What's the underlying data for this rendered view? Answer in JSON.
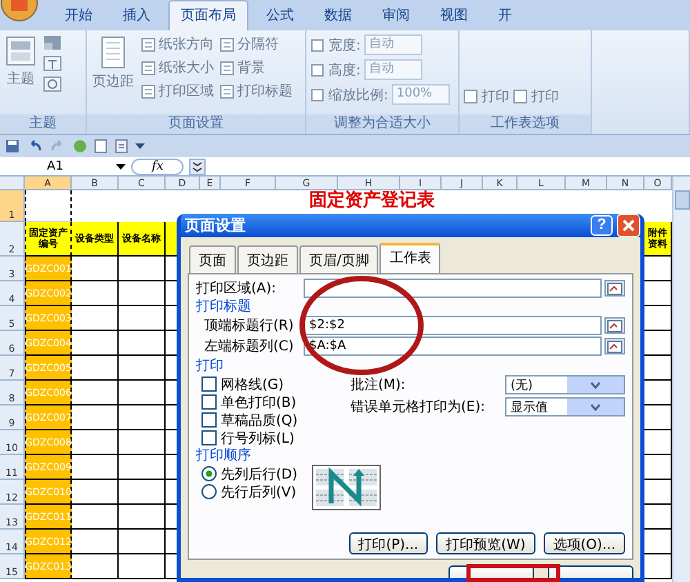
{
  "ribbon_tabs": [
    {
      "label": "开始",
      "selected": false
    },
    {
      "label": "插入",
      "selected": false
    },
    {
      "label": "页面布局",
      "selected": true
    },
    {
      "label": "公式",
      "selected": false
    },
    {
      "label": "数据",
      "selected": false
    },
    {
      "label": "审阅",
      "selected": false
    },
    {
      "label": "视图",
      "selected": false
    },
    {
      "label": "开",
      "selected": false
    }
  ],
  "theme_group": {
    "button": "主题",
    "label": "主题"
  },
  "page_setup_group": {
    "large_button": "页边距",
    "commands": [
      "纸张方向",
      "纸张大小",
      "打印区域",
      "分隔符",
      "背景",
      "打印标题"
    ],
    "label": "页面设置"
  },
  "scale_group": {
    "fields": [
      {
        "label": "宽度:",
        "value": "自动"
      },
      {
        "label": "高度:",
        "value": "自动"
      },
      {
        "label": "缩放比例:",
        "value": "100%"
      }
    ],
    "label": "调整为合适大小"
  },
  "sheet_options_group": {
    "checkboxes": [
      {
        "label": "打印",
        "checked": false
      },
      {
        "label": "打印",
        "checked": false
      }
    ],
    "label": "工作表选项"
  },
  "formula_bar": {
    "name_box": "A1",
    "function_icon": "fx"
  },
  "sheet": {
    "columns": [
      "A",
      "B",
      "C",
      "D",
      "E",
      "F",
      "G",
      "H",
      "I",
      "J",
      "K",
      "L",
      "M",
      "N",
      "O"
    ],
    "rows": [
      "1",
      "2",
      "3",
      "4",
      "5",
      "6",
      "7",
      "8",
      "9",
      "10",
      "11",
      "12",
      "13",
      "14",
      "15"
    ],
    "title": "固定资产登记表",
    "headers_left": [
      "固定资产编号",
      "设备类型",
      "设备名称"
    ],
    "header_right": "附件资料",
    "asset_ids": [
      "GDZC001",
      "GDZC002",
      "GDZC003",
      "GDZC004",
      "GDZC005",
      "GDZC006",
      "GDZC007",
      "GDZC008",
      "GDZC009",
      "GDZC010",
      "GDZC011",
      "GDZC012",
      "GDZC013"
    ]
  },
  "dialog": {
    "title": "页面设置",
    "help_button": "?",
    "tabs": [
      {
        "label": "页面",
        "selected": false
      },
      {
        "label": "页边距",
        "selected": false
      },
      {
        "label": "页眉/页脚",
        "selected": false
      },
      {
        "label": "工作表",
        "selected": true
      }
    ],
    "print_area": {
      "label": "打印区域(A):"
    },
    "print_titles": {
      "heading": "打印标题",
      "fields": [
        {
          "label": "顶端标题行(R)",
          "value": "$2:$2"
        },
        {
          "label": "左端标题列(C)",
          "value": "$A:$A"
        }
      ]
    },
    "print": {
      "heading": "打印",
      "checkboxes": [
        {
          "label": "网格线(G)",
          "checked": false
        },
        {
          "label": "单色打印(B)",
          "checked": false
        },
        {
          "label": "草稿品质(Q)",
          "checked": false
        },
        {
          "label": "行号列标(L)",
          "checked": false
        }
      ],
      "dropdowns": [
        {
          "label": "批注(M):",
          "value": "(无)"
        },
        {
          "label": "错误单元格打印为(E):",
          "value": "显示值"
        }
      ]
    },
    "page_order": {
      "heading": "打印顺序",
      "options": [
        {
          "label": "先列后行(D)",
          "selected": true
        },
        {
          "label": "先行后列(V)",
          "selected": false
        }
      ]
    },
    "buttons": [
      "打印(P)...",
      "打印预览(W)",
      "选项(O)..."
    ]
  }
}
